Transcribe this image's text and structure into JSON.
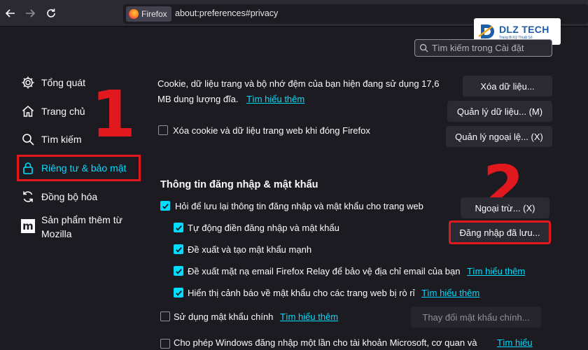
{
  "toolbar": {
    "identity_label": "Firefox",
    "url": "about:preferences#privacy"
  },
  "watermark": {
    "title": "DLZ TECH",
    "subtitle": "Trang Bị Kỹ Thuật Số"
  },
  "search": {
    "placeholder": "Tìm kiếm trong Cài đặt"
  },
  "sidebar": {
    "items": [
      {
        "label": "Tổng quát",
        "icon": "gear-icon"
      },
      {
        "label": "Trang chủ",
        "icon": "home-icon"
      },
      {
        "label": "Tìm kiếm",
        "icon": "search-icon"
      },
      {
        "label": "Riêng tư & bảo mật",
        "icon": "lock-icon"
      },
      {
        "label": "Đồng bộ hóa",
        "icon": "sync-icon"
      },
      {
        "label_line1": "Sản phẩm thêm từ",
        "label_line2": "Mozilla",
        "icon": "mozilla-icon"
      }
    ]
  },
  "annotations": {
    "step1": "1",
    "step2": "2"
  },
  "cookies": {
    "line1": "Cookie, dữ liệu trang và bộ nhớ đệm của bạn hiện đang sử dụng 17,6",
    "line2": "MB dung lượng đĩa.",
    "learn_more": "Tìm hiểu thêm",
    "clear_data_button": "Xóa dữ liệu...",
    "manage_data_button": "Quản lý dữ liệu... (M)",
    "manage_exceptions_button": "Quản lý ngoại lệ... (X)",
    "delete_on_close_label": "Xóa cookie và dữ liệu trang web khi đóng Firefox"
  },
  "logins": {
    "heading": "Thông tin đăng nhập & mật khẩu",
    "ask_save_label": "Hỏi để lưu lại thông tin đăng nhập và mật khẩu cho trang web",
    "exceptions_button": "Ngoại trừ... (X)",
    "saved_logins_button": "Đăng nhập đã lưu...",
    "autofill_label": "Tự động điền đăng nhập và mật khẩu",
    "suggest_strong_label": "Đề xuất và tạo mật khẩu mạnh",
    "relay_label": "Đề xuất mặt nạ email Firefox Relay để bảo vệ địa chỉ email của bạn",
    "relay_learn_more": "Tìm hiểu thêm",
    "breach_label": "Hiển thị cảnh báo về mật khẩu cho các trang web bị rò rỉ",
    "breach_learn_more": "Tìm hiểu thêm",
    "primary_password_label": "Sử dụng mật khẩu chính",
    "primary_password_learn_more": "Tìm hiểu thêm",
    "change_primary_button": "Thay đổi mật khẩu chính...",
    "windows_sso_label": "Cho phép Windows đăng nhập một lần cho tài khoản Microsoft, cơ quan và",
    "windows_sso_learn_more": "Tìm hiểu"
  },
  "colors": {
    "accent": "#00ddff",
    "highlight_red": "#e1181e",
    "background": "#1c1b22"
  }
}
